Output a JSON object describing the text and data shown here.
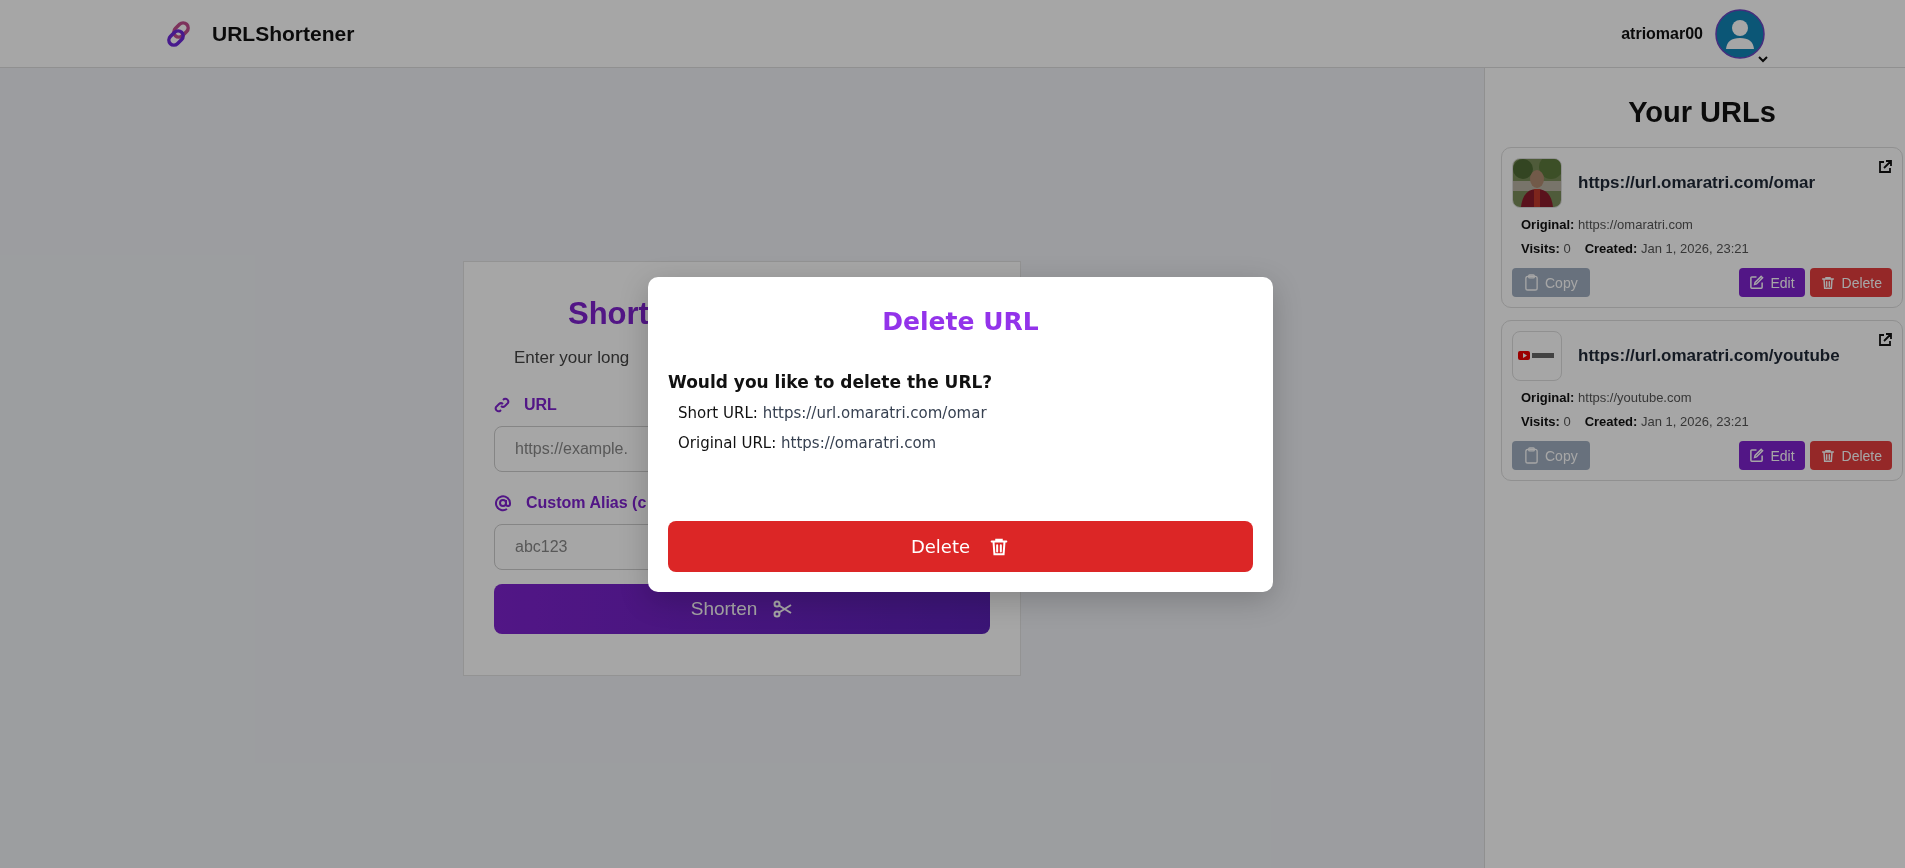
{
  "header": {
    "brand": "URLShortener",
    "username": "atriomar00"
  },
  "form": {
    "title": "Short",
    "subtitle": "Enter your long",
    "url_label": "URL",
    "url_placeholder": "https://example.",
    "alias_label": "Custom Alias (c",
    "alias_placeholder": "abc123",
    "submit": "Shorten"
  },
  "sidebar": {
    "title": "Your URLs",
    "urls": [
      {
        "short_url": "https://url.omaratri.com/omar",
        "original_label": "Original:",
        "original": "https://omaratri.com",
        "visits_label": "Visits:",
        "visits": "0",
        "created_label": "Created:",
        "created": "Jan 1, 2026, 23:21",
        "buttons": [
          {
            "kind": "copy",
            "label": "Copy"
          },
          {
            "kind": "edit",
            "label": "Edit"
          },
          {
            "kind": "delete",
            "label": "Delete"
          }
        ]
      },
      {
        "thumbnail": {
          "kind": "logo"
        },
        "short_url": "https://url.omaratri.com/youtube",
        "original_label": "Original:",
        "original": "https://youtube.com",
        "visits_label": "Visits:",
        "visits": "0",
        "created_label": "Created:",
        "created": "Jan 1, 2026, 23:21",
        "buttons": [
          {
            "kind": "copy",
            "label": "Copy"
          },
          {
            "kind": "edit",
            "label": "Edit"
          },
          {
            "kind": "delete",
            "label": "Delete"
          }
        ]
      }
    ]
  },
  "modal": {
    "title": "Delete URL",
    "question": "Would you like to delete the URL?",
    "details": [
      {
        "label": "Short URL:",
        "value": "https://url.omaratri.com/omar"
      },
      {
        "label": "Original URL:",
        "value": "https://omaratri.com"
      }
    ],
    "button": "Delete"
  }
}
